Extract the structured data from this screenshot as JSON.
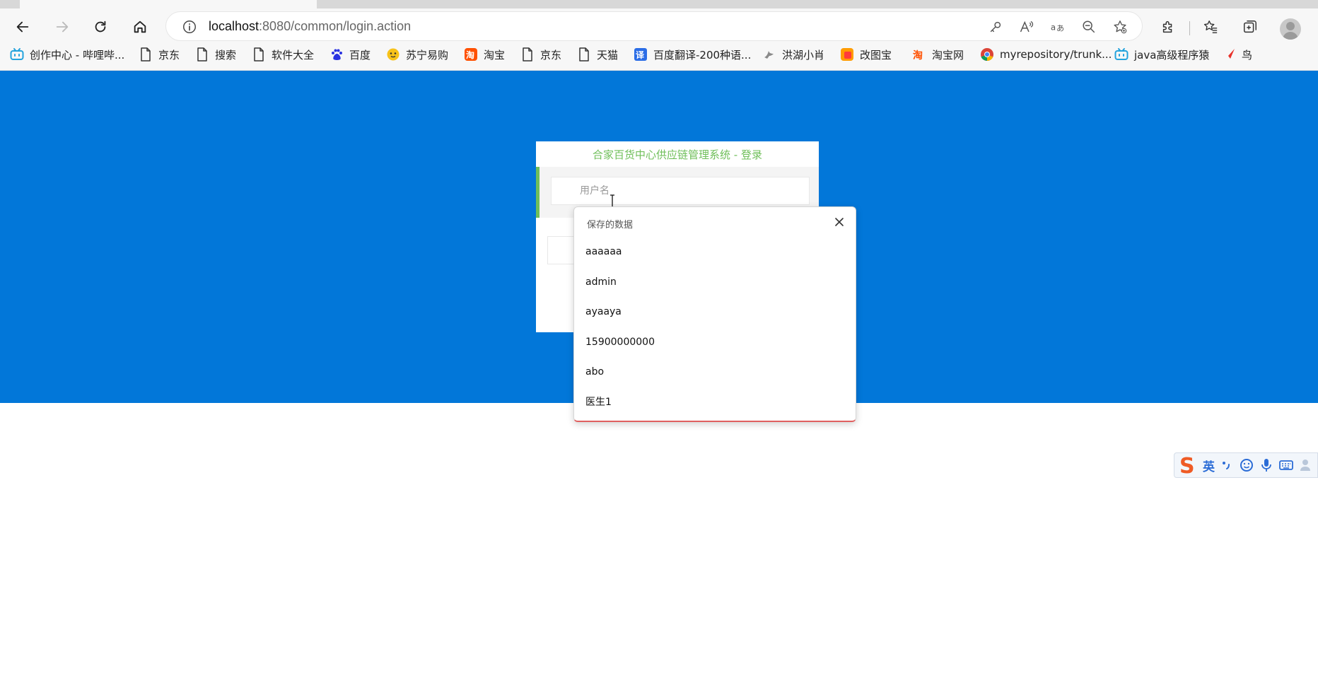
{
  "browser": {
    "url_host": "localhost",
    "url_path": ":8080/common/login.action"
  },
  "bookmarks": [
    {
      "label": "创作中心 - 哔哩哔...",
      "icon": "bilibili-icon"
    },
    {
      "label": "京东",
      "icon": "page-icon"
    },
    {
      "label": "搜索",
      "icon": "page-icon"
    },
    {
      "label": "软件大全",
      "icon": "page-icon"
    },
    {
      "label": "百度",
      "icon": "baidu-icon"
    },
    {
      "label": "苏宁易购",
      "icon": "suning-icon"
    },
    {
      "label": "淘宝",
      "icon": "taobao-icon"
    },
    {
      "label": "京东",
      "icon": "page-icon"
    },
    {
      "label": "天猫",
      "icon": "page-icon"
    },
    {
      "label": "百度翻译-200种语...",
      "icon": "translate-icon"
    },
    {
      "label": "洪湖小肖",
      "icon": "bird-icon"
    },
    {
      "label": "改图宝",
      "icon": "gaitubao-icon"
    },
    {
      "label": "淘宝网",
      "icon": "taobao-icon"
    },
    {
      "label": "myrepository/trunk...",
      "icon": "chrome-icon"
    },
    {
      "label": "java高级程序猿",
      "icon": "bilibili-icon"
    },
    {
      "label": "鸟",
      "icon": "bird-red-icon"
    }
  ],
  "login": {
    "title": "合家百货中心供应链管理系统 - 登录",
    "username_placeholder": "用户名"
  },
  "autofill": {
    "header": "保存的数据",
    "items": [
      "aaaaaa",
      "admin",
      "ayaaya",
      "15900000000",
      "abo",
      "医生1"
    ]
  },
  "ime": {
    "label": "英"
  },
  "colors": {
    "banner": "#0277d9",
    "title_green": "#6fbf5a"
  }
}
